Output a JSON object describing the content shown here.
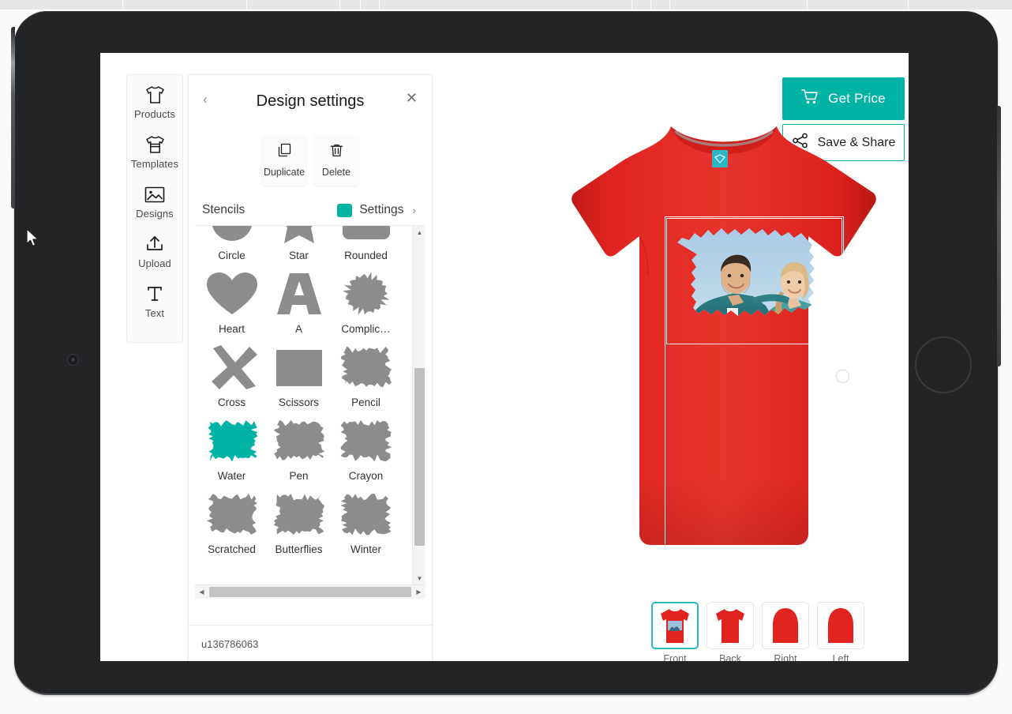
{
  "app": {
    "panel_title": "Design settings",
    "back_icon": "chevron-left-icon",
    "close_icon": "close-icon",
    "design_id": "u136786063"
  },
  "rail": {
    "items": [
      {
        "label": "Products",
        "icon": "tshirt-icon"
      },
      {
        "label": "Templates",
        "icon": "tshirt-stack-icon"
      },
      {
        "label": "Designs",
        "icon": "image-icon"
      },
      {
        "label": "Upload",
        "icon": "upload-icon"
      },
      {
        "label": "Text",
        "icon": "text-icon"
      }
    ]
  },
  "actions": [
    {
      "label": "Duplicate",
      "icon": "duplicate-icon"
    },
    {
      "label": "Delete",
      "icon": "trash-icon"
    }
  ],
  "stencils": {
    "section_label": "Stencils",
    "settings_label": "Settings",
    "settings_chevron": "›",
    "swatch_color": "#00b3a4",
    "selected": "Water",
    "items": [
      {
        "label": "Circle",
        "shape": "circle",
        "color": "#8c8c8c"
      },
      {
        "label": "Star",
        "shape": "star",
        "color": "#8c8c8c"
      },
      {
        "label": "Rounded",
        "shape": "rounded",
        "color": "#8c8c8c"
      },
      {
        "label": "Heart",
        "shape": "heart",
        "color": "#8c8c8c"
      },
      {
        "label": "A",
        "shape": "letter-a",
        "color": "#8c8c8c"
      },
      {
        "label": "Complic…",
        "shape": "splatter",
        "color": "#8c8c8c"
      },
      {
        "label": "Cross",
        "shape": "cross",
        "color": "#8c8c8c"
      },
      {
        "label": "Scissors",
        "shape": "rect",
        "color": "#8c8c8c"
      },
      {
        "label": "Pencil",
        "shape": "rough",
        "color": "#8c8c8c"
      },
      {
        "label": "Water",
        "shape": "rough",
        "color": "#00b3a4"
      },
      {
        "label": "Pen",
        "shape": "rough",
        "color": "#8c8c8c"
      },
      {
        "label": "Crayon",
        "shape": "rough",
        "color": "#8c8c8c"
      },
      {
        "label": "Scratched",
        "shape": "rough",
        "color": "#8c8c8c"
      },
      {
        "label": "Butterflies",
        "shape": "rough",
        "color": "#8c8c8c"
      },
      {
        "label": "Winter",
        "shape": "rough",
        "color": "#8c8c8c"
      }
    ]
  },
  "toolbar": {
    "get_price_label": "Get Price",
    "get_price_icon": "cart-icon",
    "save_share_label": "Save & Share",
    "save_share_icon": "share-icon",
    "accent_color": "#00b3a4"
  },
  "product": {
    "color": "#e0231f",
    "neck_label_color": "#2bb7c4",
    "views": [
      {
        "label": "Front",
        "active": true
      },
      {
        "label": "Back",
        "active": false
      },
      {
        "label": "Right",
        "active": false
      },
      {
        "label": "Left",
        "active": false
      }
    ]
  },
  "scrollbars": {
    "v_up": "▲",
    "v_down": "▼",
    "h_left": "◀",
    "h_right": "▶"
  }
}
